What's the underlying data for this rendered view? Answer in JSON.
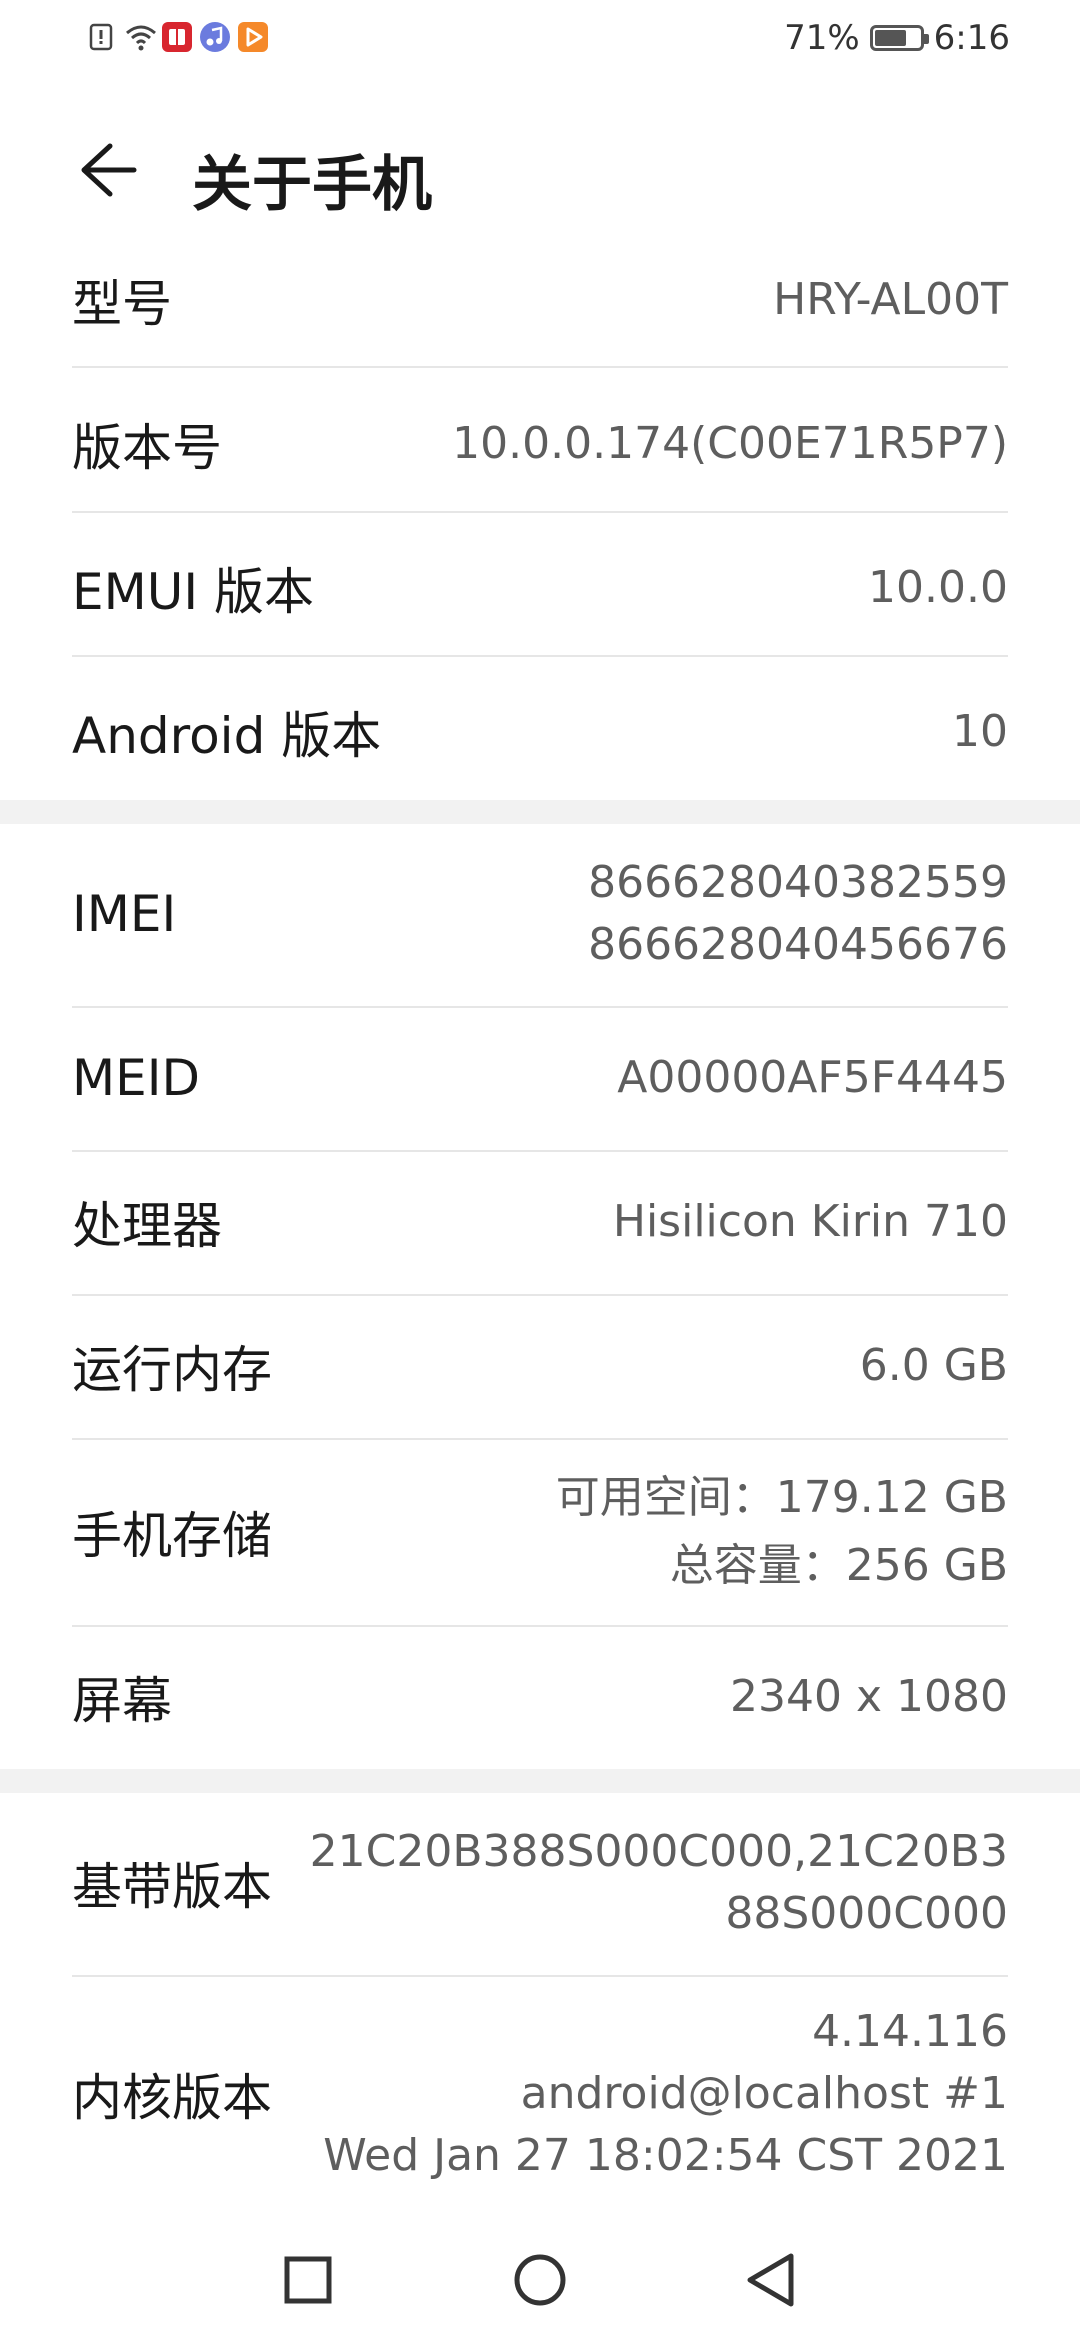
{
  "status_bar": {
    "battery_percent": "71%",
    "battery_level": 0.71,
    "time": "6:16",
    "icons": [
      "sim-alert-icon",
      "wifi-icon",
      "book-app-icon",
      "music-app-icon",
      "video-app-icon"
    ]
  },
  "header": {
    "title": "关于手机",
    "back_icon": "arrow-left-icon"
  },
  "section1": [
    {
      "label": "型号",
      "value": "HRY-AL00T"
    },
    {
      "label": "版本号",
      "value": "10.0.0.174(C00E71R5P7)"
    },
    {
      "label": "EMUI 版本",
      "value": "10.0.0"
    },
    {
      "label": "Android 版本",
      "value": "10"
    }
  ],
  "section2": {
    "imei": {
      "label": "IMEI",
      "value1": "866628040382559",
      "value2": "866628040456676"
    },
    "meid": {
      "label": "MEID",
      "value": "A00000AF5F4445"
    },
    "cpu": {
      "label": "处理器",
      "value": "Hisilicon Kirin 710"
    },
    "ram": {
      "label": "运行内存",
      "value": "6.0 GB"
    },
    "storage": {
      "label": "手机存储",
      "value1": "可用空间：179.12  GB",
      "value2": "总容量：256  GB"
    },
    "screen": {
      "label": "屏幕",
      "value": "2340 x 1080"
    }
  },
  "section3": {
    "baseband": {
      "label": "基带版本",
      "value1": "21C20B388S000C000,21C20B3",
      "value2": "88S000C000"
    },
    "kernel": {
      "label": "内核版本",
      "value1": "4.14.116",
      "value2": "android@localhost #1",
      "value3": "Wed Jan 27 18:02:54 CST 2021"
    }
  },
  "nav_bar": {
    "icons": [
      "recent-apps-icon",
      "home-icon",
      "back-icon"
    ]
  },
  "colors": {
    "section_gap": "#f2f2f2",
    "divider": "#e6e6e6",
    "value_text": "#5e5e5e",
    "label_text": "#191919"
  }
}
